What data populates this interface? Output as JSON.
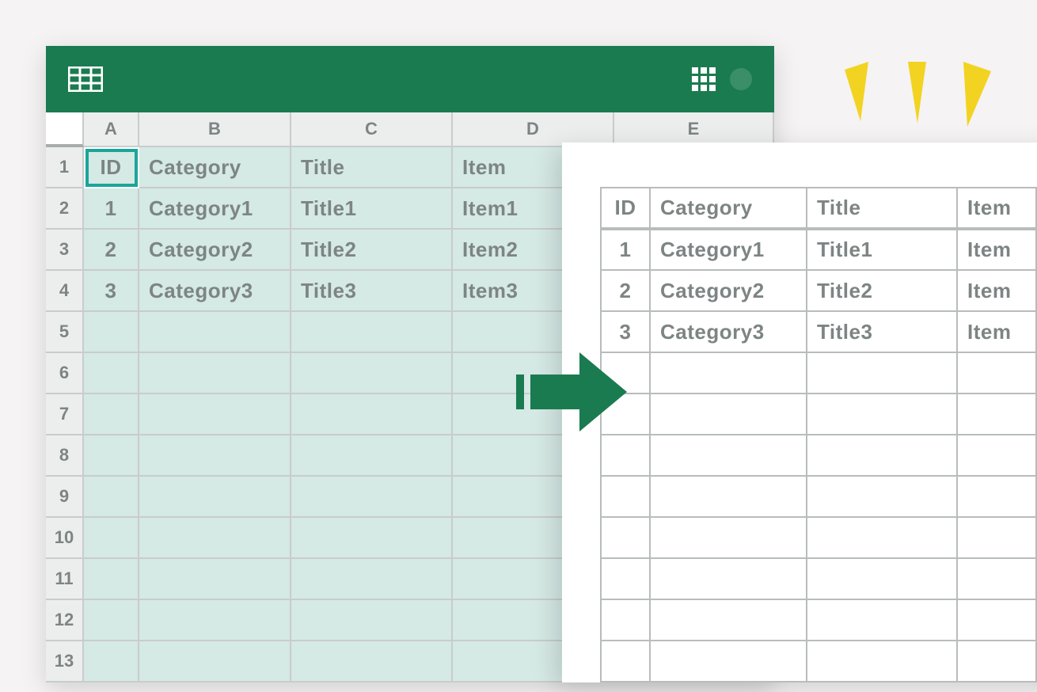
{
  "source": {
    "columns": [
      "A",
      "B",
      "C",
      "D",
      "E"
    ],
    "row_numbers": [
      "1",
      "2",
      "3",
      "4",
      "5",
      "6",
      "7",
      "8",
      "9",
      "10",
      "11",
      "12",
      "13"
    ],
    "headers": {
      "id": "ID",
      "category": "Category",
      "title": "Title",
      "item": "Item"
    },
    "data": [
      {
        "id": "1",
        "category": "Category1",
        "title": "Title1",
        "item": "Item1"
      },
      {
        "id": "2",
        "category": "Category2",
        "title": "Title2",
        "item": "Item2"
      },
      {
        "id": "3",
        "category": "Category3",
        "title": "Title3",
        "item": "Item3"
      }
    ]
  },
  "target": {
    "headers": {
      "id": "ID",
      "category": "Category",
      "title": "Title",
      "item": "Item"
    },
    "data": [
      {
        "id": "1",
        "category": "Category1",
        "title": "Title1",
        "item": "Item"
      },
      {
        "id": "2",
        "category": "Category2",
        "title": "Title2",
        "item": "Item"
      },
      {
        "id": "3",
        "category": "Category3",
        "title": "Title3",
        "item": "Item"
      }
    ]
  }
}
